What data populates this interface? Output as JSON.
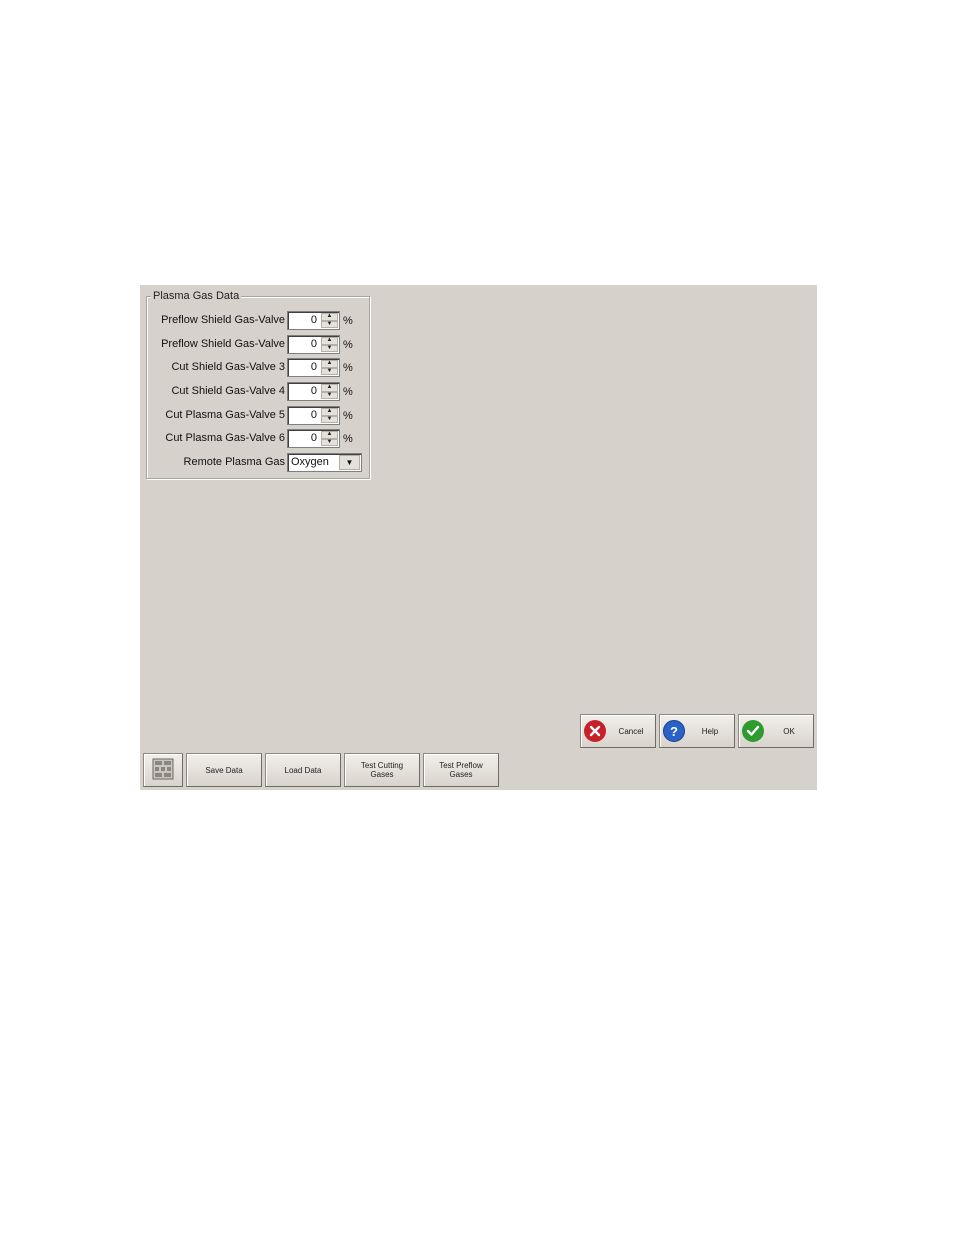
{
  "groupbox": {
    "title": "Plasma Gas Data"
  },
  "rows": [
    {
      "label": "Preflow Shield Gas-Valve",
      "value": "0",
      "unit": "%"
    },
    {
      "label": "Preflow Shield Gas-Valve",
      "value": "0",
      "unit": "%"
    },
    {
      "label": "Cut Shield Gas-Valve 3",
      "value": "0",
      "unit": "%"
    },
    {
      "label": "Cut Shield Gas-Valve 4",
      "value": "0",
      "unit": "%"
    },
    {
      "label": "Cut Plasma Gas-Valve 5",
      "value": "0",
      "unit": "%"
    },
    {
      "label": "Cut Plasma Gas-Valve 6",
      "value": "0",
      "unit": "%"
    }
  ],
  "remote_gas": {
    "label": "Remote Plasma Gas",
    "value": "Oxygen"
  },
  "dialog_buttons": {
    "cancel": "Cancel",
    "help": "Help",
    "ok": "OK"
  },
  "toolbar": {
    "save": "Save Data",
    "load": "Load Data",
    "test_cutting": "Test Cutting Gases",
    "test_preflow": "Test Preflow Gases"
  },
  "icons": {
    "cancel": "cancel-x-icon",
    "help": "help-question-icon",
    "ok": "ok-check-icon",
    "toolbar": "gas-data-grid-icon"
  },
  "colors": {
    "panel": "#d6d1cb",
    "cancel": "#c8202a",
    "help": "#2a63c8",
    "ok": "#2f9a2f"
  }
}
